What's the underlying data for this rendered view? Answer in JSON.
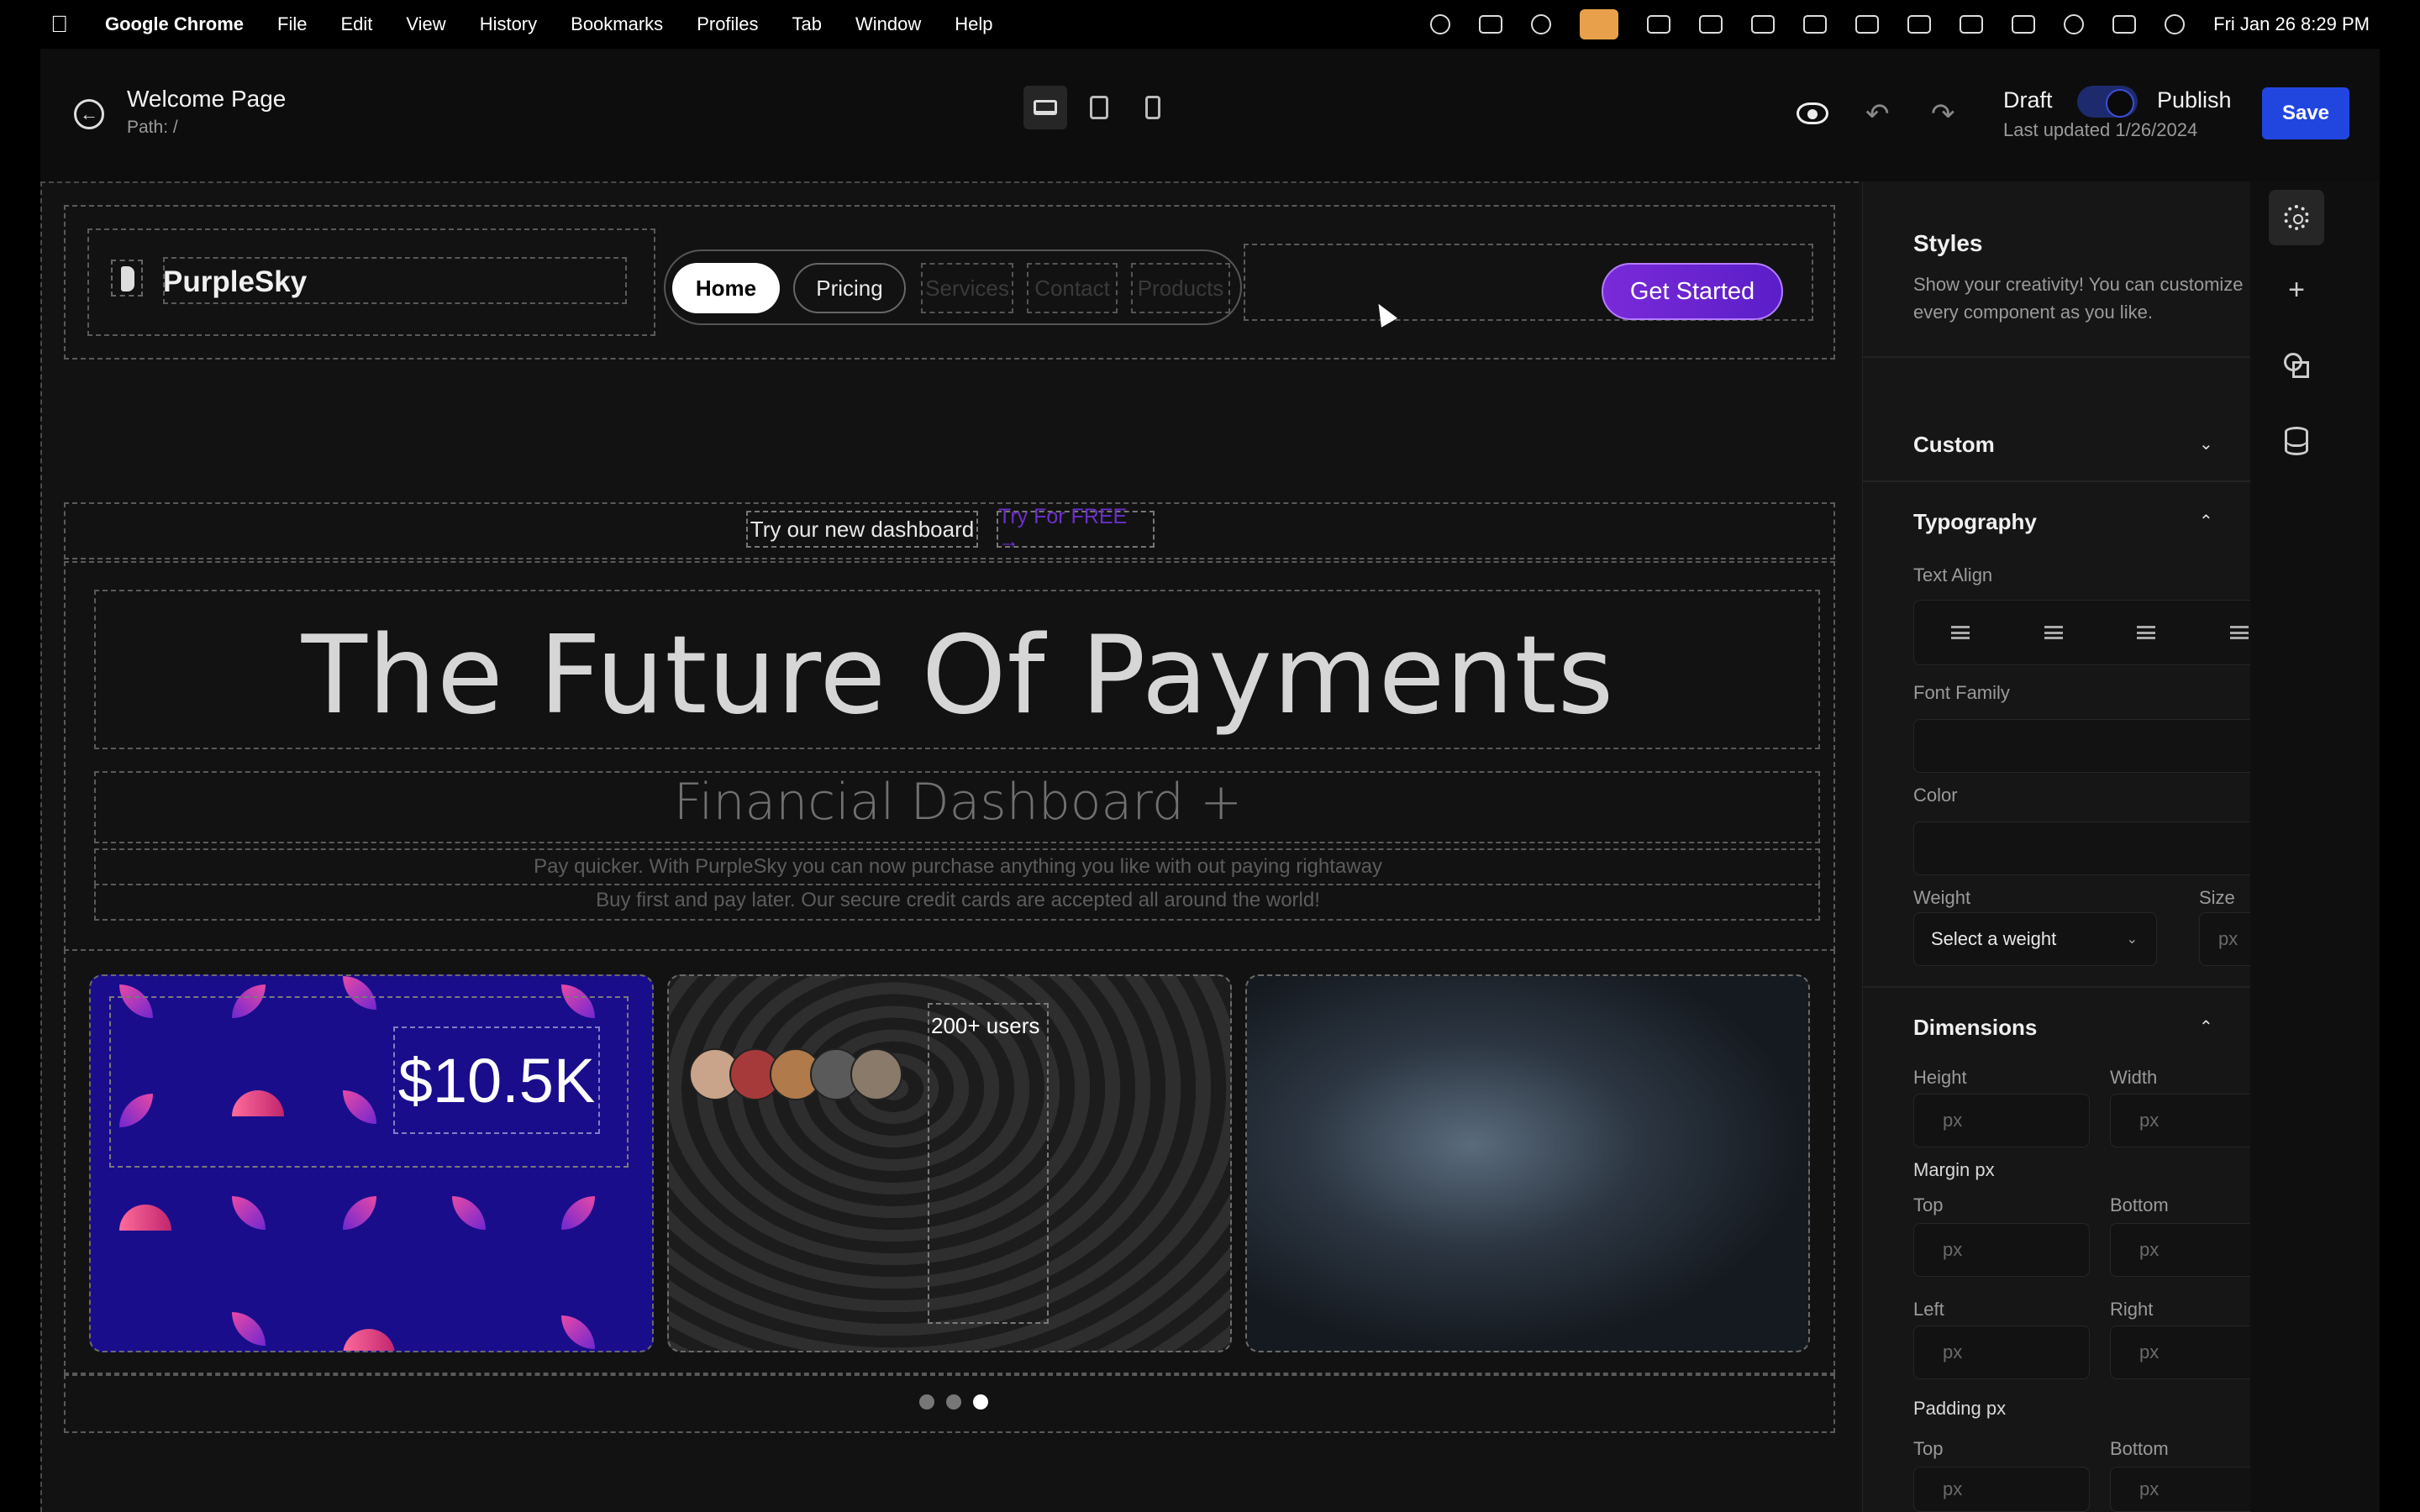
{
  "menubar": {
    "app_name": "Google Chrome",
    "items": [
      "File",
      "Edit",
      "View",
      "History",
      "Bookmarks",
      "Profiles",
      "Tab",
      "Window",
      "Help"
    ],
    "clock": "Fri Jan 26  8:29 PM"
  },
  "toolbar": {
    "page_title": "Welcome Page",
    "page_path": "Path: /",
    "draft_label": "Draft",
    "publish_label": "Publish",
    "last_updated": "Last updated 1/26/2024",
    "save_label": "Save",
    "publish_toggle_on": true,
    "active_device": "desktop"
  },
  "site": {
    "logo_text": "PurpleSky",
    "nav": [
      "Home",
      "Pricing",
      "Services",
      "Contact",
      "Products"
    ],
    "active_nav": "Home",
    "cta_label": "Get Started",
    "announcement_text": "Try our new dashboard",
    "announcement_link": "Try For FREE →",
    "hero_title": "The Future Of Payments",
    "hero_subtitle": "Financial Dashboard +",
    "hero_line_1": "Pay quicker. With PurpleSky you can now purchase anything you like with out paying rightaway",
    "hero_line_2": "Buy first and pay later. Our secure credit cards are accepted all around the world!",
    "card_value": "$10.5K",
    "users_label": "200+ users",
    "carousel_dots": 3,
    "carousel_active_index": 2
  },
  "panel": {
    "title": "Styles",
    "description": "Show your creativity! You can customize every component as you like.",
    "custom_label": "Custom",
    "typography_label": "Typography",
    "text_align_label": "Text Align",
    "font_family_label": "Font Family",
    "color_label": "Color",
    "weight_label": "Weight",
    "weight_placeholder": "Select a weight",
    "size_label": "Size",
    "unit_placeholder": "px",
    "dimensions_label": "Dimensions",
    "height_label": "Height",
    "width_label": "Width",
    "margin_label": "Margin px",
    "padding_label": "Padding px",
    "top_label": "Top",
    "bottom_label": "Bottom",
    "left_label": "Left",
    "right_label": "Right"
  },
  "colors": {
    "accent": "#2146e0",
    "cta_purple": "#7a2ad8",
    "card_blue": "#1a0d8c"
  }
}
